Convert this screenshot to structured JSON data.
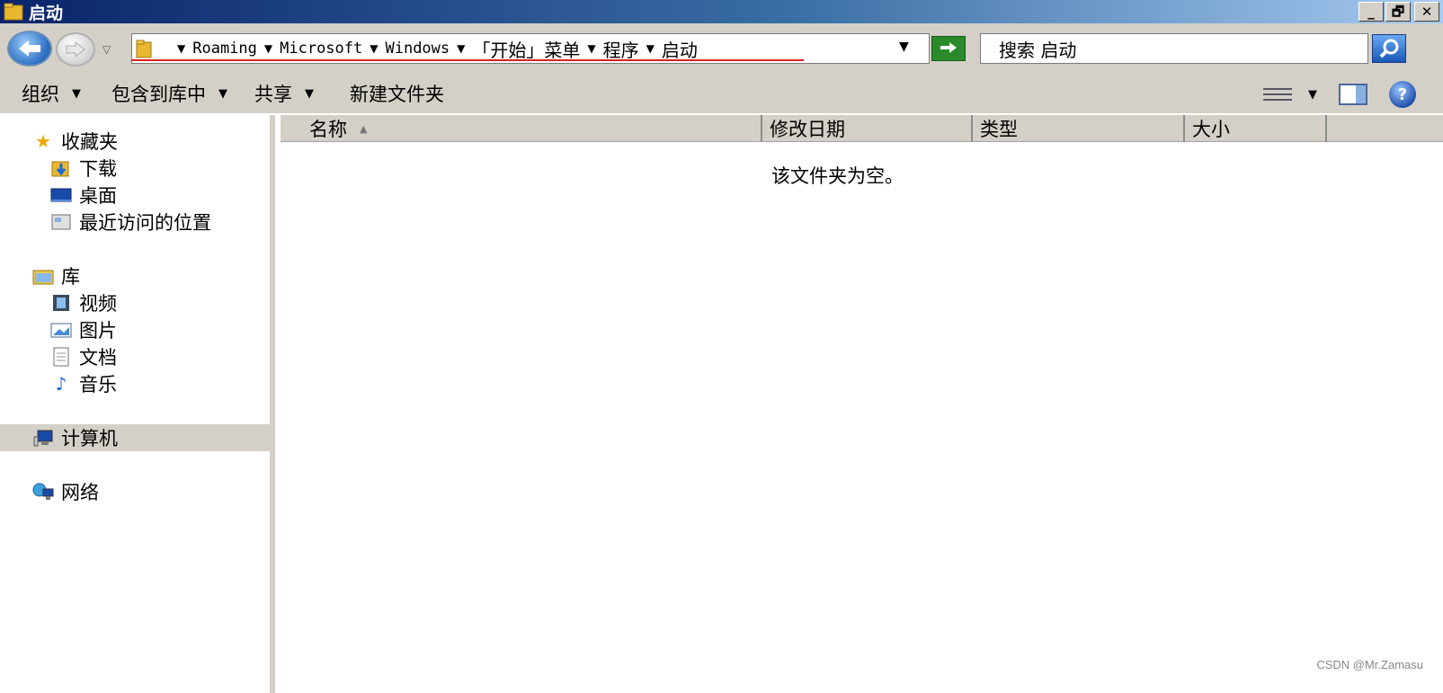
{
  "window": {
    "title": "启动"
  },
  "title_buttons": {
    "minimize": "_",
    "restore": "🗗",
    "close": "✕"
  },
  "address": {
    "crumbs": [
      "Roaming",
      "Microsoft",
      "Windows",
      "「开始」菜单",
      "程序",
      "启动"
    ],
    "search_placeholder": "搜索 启动"
  },
  "toolbar": {
    "organize": "组织",
    "include_in_library": "包含到库中",
    "share": "共享",
    "new_folder": "新建文件夹"
  },
  "nav": {
    "favorites": {
      "label": "收藏夹",
      "items": [
        "下载",
        "桌面",
        "最近访问的位置"
      ]
    },
    "libraries": {
      "label": "库",
      "items": [
        "视频",
        "图片",
        "文档",
        "音乐"
      ]
    },
    "computer": "计算机",
    "network": "网络"
  },
  "columns": {
    "name": "名称",
    "modified": "修改日期",
    "type": "类型",
    "size": "大小"
  },
  "empty_message": "该文件夹为空。",
  "watermark": "CSDN @Mr.Zamasu"
}
